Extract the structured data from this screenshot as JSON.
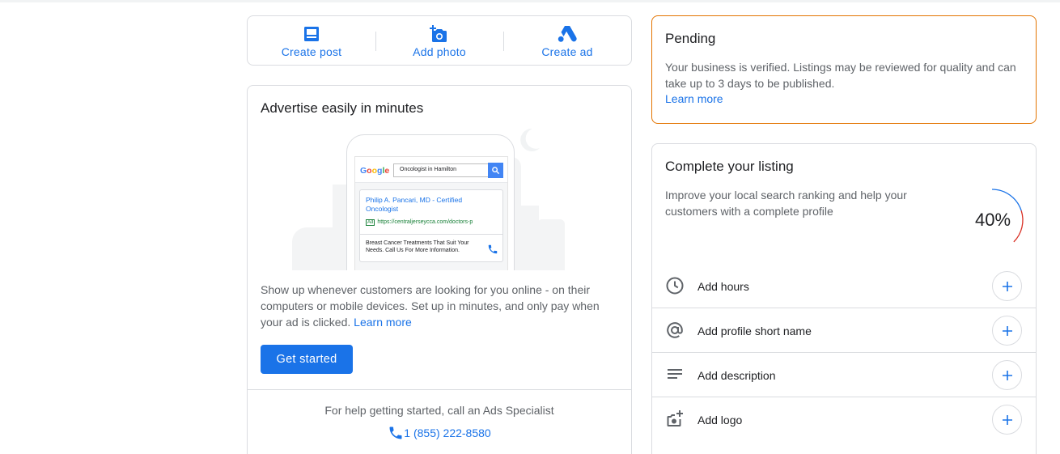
{
  "actions": [
    {
      "label": "Create post",
      "icon": "post-icon"
    },
    {
      "label": "Add photo",
      "icon": "add-photo-icon"
    },
    {
      "label": "Create ad",
      "icon": "google-ads-icon"
    }
  ],
  "advertise": {
    "title": "Advertise easily in minutes",
    "illustration": {
      "google_logo": "Google",
      "search_query": "Oncologist in Hamilton",
      "ad_headline": "Philip A. Pancari, MD - Certified Oncologist",
      "ad_badge": "Ad",
      "ad_url": "https://centraljerseycca.com/doctors-p",
      "ad_description": "Breast Cancer Treatments That Suit Your Needs. Call Us For More Information."
    },
    "body": "Show up whenever customers are looking for you online - on their computers or mobile devices. Set up in minutes, and only pay when your ad is clicked.",
    "learn_more": "Learn more",
    "cta": "Get started",
    "help_text": "For help getting started, call an Ads Specialist",
    "phone": "1 (855) 222-8580"
  },
  "pending": {
    "title": "Pending",
    "text": "Your business is verified. Listings may be reviewed for quality and can take up to 3 days to be published.",
    "learn_more": "Learn more"
  },
  "complete": {
    "title": "Complete your listing",
    "text": "Improve your local search ranking and help your customers with a complete profile",
    "progress_label": "40%",
    "progress_fraction": 0.4,
    "tasks": [
      {
        "label": "Add hours",
        "icon": "clock-icon"
      },
      {
        "label": "Add profile short name",
        "icon": "at-sign-icon"
      },
      {
        "label": "Add description",
        "icon": "description-icon"
      },
      {
        "label": "Add logo",
        "icon": "add-logo-icon"
      }
    ]
  },
  "colors": {
    "accent": "#1a73e8",
    "pending_border": "#e37400",
    "progress_red": "#d93025"
  }
}
